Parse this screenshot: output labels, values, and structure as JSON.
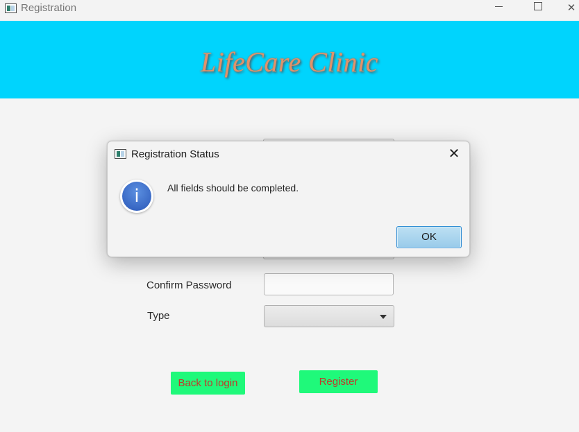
{
  "window": {
    "title": "Registration",
    "controls": {
      "minimize": "",
      "maximize": "",
      "close": "✕"
    }
  },
  "banner": {
    "title": "LifeCare Clinic",
    "color": "#00d4fd"
  },
  "form": {
    "confirm_password_label": "Confirm Password",
    "confirm_password_value": "",
    "type_label": "Type",
    "type_selected": ""
  },
  "buttons": {
    "back_to_login": "Back to login",
    "register": "Register",
    "accent": "#1ff97a"
  },
  "dialog": {
    "title": "Registration Status",
    "message": "All fields should be completed.",
    "icon": "info-icon",
    "icon_glyph": "i",
    "ok_label": "OK",
    "close_glyph": "✕"
  }
}
